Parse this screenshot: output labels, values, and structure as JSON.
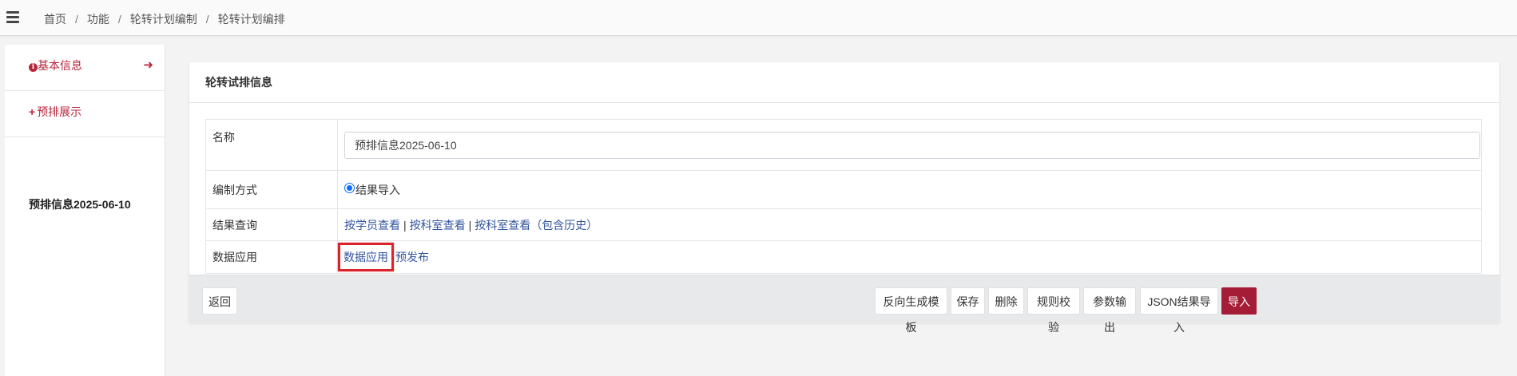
{
  "breadcrumb": {
    "items": [
      "首页",
      "功能",
      "轮转计划编制",
      "轮转计划编排"
    ],
    "separator": "/"
  },
  "sidebar": {
    "items": [
      {
        "label": "基本信息",
        "icon": "info-circle-icon"
      },
      {
        "label": "预排展示",
        "icon": "plus-icon"
      }
    ],
    "arrow_icon": "arrow-right-icon",
    "current": "预排信息2025-06-10"
  },
  "panel": {
    "title": "轮转试排信息",
    "rows": {
      "name": {
        "label": "名称",
        "value": "预排信息2025-06-10"
      },
      "mode": {
        "label": "编制方式",
        "option": "结果导入",
        "selected": true
      },
      "query": {
        "label": "结果查询",
        "links": [
          "按学员查看",
          "按科室查看",
          "按科室查看（包含历史）"
        ],
        "separator": "|"
      },
      "data": {
        "label": "数据应用",
        "links": [
          "数据应用",
          "预发布"
        ]
      }
    }
  },
  "footer": {
    "back": "返回",
    "buttons": [
      "反向生成模板",
      "保存",
      "删除",
      "规则校验",
      "参数输出",
      "JSON结果导入"
    ],
    "primary": "导入"
  },
  "colors": {
    "accent": "#b7263c",
    "primary_button": "#a51c36",
    "link": "#3254a0",
    "highlight_border": "#d9242b"
  }
}
